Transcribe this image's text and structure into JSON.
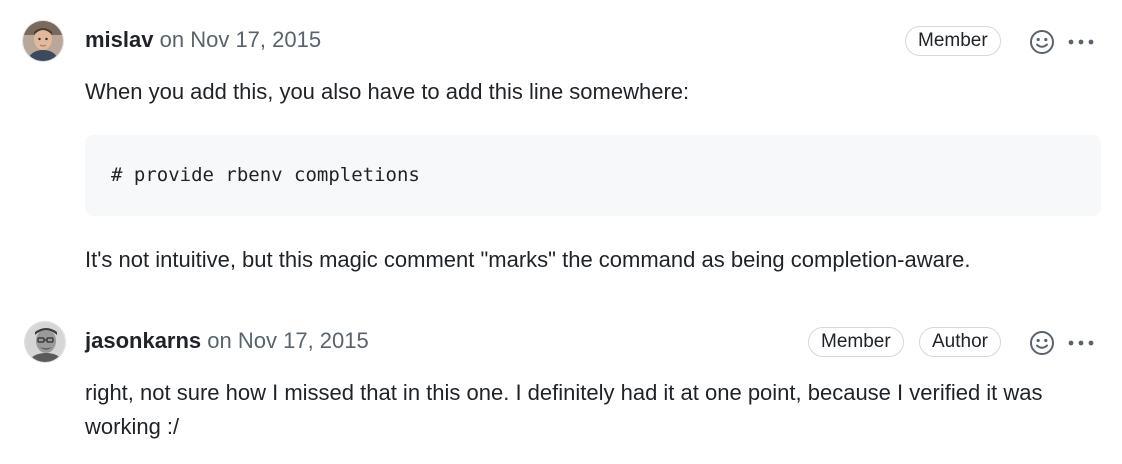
{
  "comments": [
    {
      "author": "mislav",
      "date_text": "on Nov 17, 2015",
      "badges": [
        "Member"
      ],
      "body_before_code": "When you add this, you also have to add this line somewhere:",
      "code": "# provide rbenv completions",
      "body_after_code": "It's not intuitive, but this magic comment \"marks\" the command as being completion-aware."
    },
    {
      "author": "jasonkarns",
      "date_text": "on Nov 17, 2015",
      "badges": [
        "Member",
        "Author"
      ],
      "body": "right, not sure how I missed that in this one. I definitely had it at one point, because I verified it was working :/"
    }
  ],
  "icons": {
    "reaction": "smiley-icon",
    "more": "kebab-horizontal-icon"
  },
  "colors": {
    "text": "#1f2328",
    "muted": "#59636e",
    "border": "#d1d9e0",
    "code_bg": "#f6f8fa"
  }
}
